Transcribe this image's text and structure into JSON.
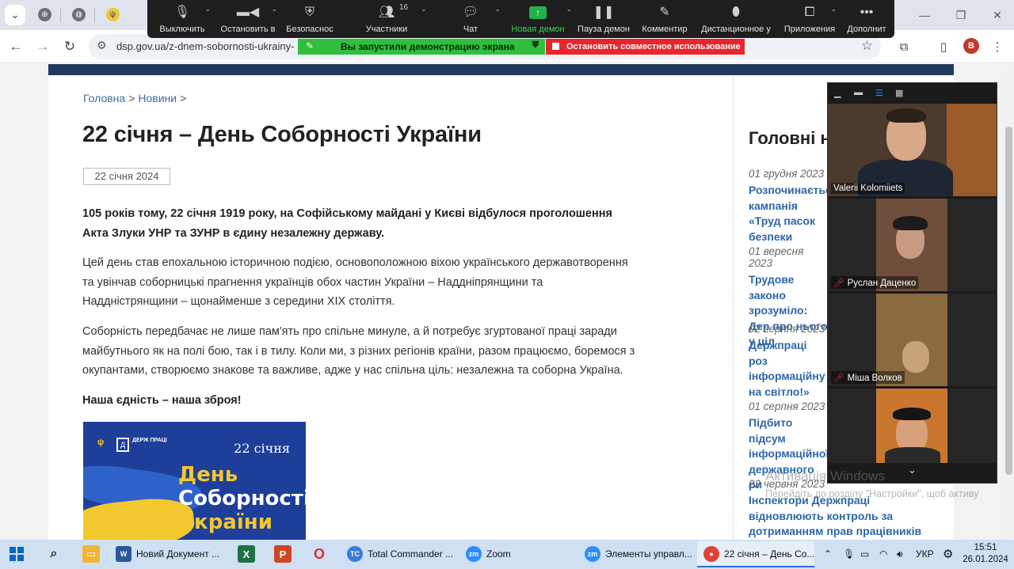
{
  "browser": {
    "url": "dsp.gov.ua/z-dnem-sobornosti-ukrainy-",
    "profile_initial": "B"
  },
  "zoom_toolbar": {
    "items": [
      {
        "label": "Выключить",
        "icon": "microphone-icon"
      },
      {
        "label": "Остановить в",
        "icon": "video-camera-icon"
      },
      {
        "label": "Безопаснос",
        "icon": "shield-icon"
      },
      {
        "label": "Участники",
        "icon": "participants-icon",
        "count": "16"
      },
      {
        "label": "Чат",
        "icon": "chat-icon"
      },
      {
        "label": "Новая демон",
        "icon": "share-screen-icon"
      },
      {
        "label": "Пауза демон",
        "icon": "pause-icon"
      },
      {
        "label": "Комментир",
        "icon": "pencil-icon"
      },
      {
        "label": "Дистанционное у",
        "icon": "mouse-icon"
      },
      {
        "label": "Приложения",
        "icon": "apps-icon"
      },
      {
        "label": "Дополнит",
        "icon": "more-icon"
      }
    ],
    "share_banner": "Вы запустили демонстрацию экрана",
    "stop_share": "Остановить совместное использование",
    "accent_green": "#2fbf3d",
    "accent_red": "#e8262d"
  },
  "article": {
    "breadcrumb": [
      "Головна",
      "Новини"
    ],
    "title": "22 січня – День Соборності України",
    "date": "22 січня 2024",
    "lead": "105 років тому, 22 січня 1919 року, на Софійському майдані у Києві відбулося проголошення Акта Злуки УНР та ЗУНР в єдину незалежну державу.",
    "p1": "Цей день став епохальною історичною подією, основоположною віхою українського державотворення та увінчав соборницькі прагнення українців обох частин України – Наддніпрянщини та Наддністрянщини – щонайменше з середини XIX століття.",
    "p2": "Соборність передбачає не лише пам'ять про спільне минуле, а й потребує згуртованої праці заради майбутнього як на полі бою, так і в тилу. Коли ми, з різних регіонів країни, разом працюємо, боремося з окупантами, створюємо знакове та важливе, адже у нас спільна ціль: незалежна та соборна Україна.",
    "motto": "Наша єдність – наша зброя!",
    "banner": {
      "logo_text": "ДЕРЖ ПРАЦІ",
      "date": "22 січня",
      "line1": "День",
      "line2": "Соборності",
      "line3": "України"
    }
  },
  "sidebar": {
    "title": "Головні новини",
    "items": [
      {
        "date": "01 грудня 2023",
        "title": "Розпочинаєтьс кампанія «Труд пасок безпеки"
      },
      {
        "date": "01 вересня 2023",
        "title": "Трудове законо зрозуміло: Дер про нього у ціл"
      },
      {
        "date": "02 серпня 2023",
        "title": "Держпраці роз інформаційну на світло!»"
      },
      {
        "date": "01 серпня 2023",
        "title": "Підбито підсум інформаційної державного ри"
      },
      {
        "date": "22 червня 2023",
        "title": "Інспектори Держпраці відновлюють контроль за дотриманням прав працівників"
      }
    ]
  },
  "zoom_panel": {
    "participants": [
      {
        "name": "Valerii Kolomiiets",
        "muted": false
      },
      {
        "name": "Руслан Даценко",
        "muted": true
      },
      {
        "name": "Міша Волков",
        "muted": true
      },
      {
        "name": "",
        "muted": false
      }
    ]
  },
  "watermark": {
    "title": "Активація Windows",
    "text": "Перейдіть до розділу \"Настройки\", щоб активувати Windows."
  },
  "taskbar": {
    "apps": [
      {
        "label": "Новий Документ ...",
        "icon": "word-icon",
        "color": "#2b579a"
      },
      {
        "label": "Total Commander ...",
        "icon": "total-commander-icon",
        "color": "#3a7bd5"
      },
      {
        "label": "Zoom",
        "icon": "zoom-icon",
        "color": "#2d8cff"
      },
      {
        "label": "Элементы управл...",
        "icon": "zoom-icon",
        "color": "#2d8cff"
      },
      {
        "label": "22 січня – День Со...",
        "icon": "chrome-icon",
        "color": "#db4437"
      }
    ],
    "language": "УКР",
    "time": "15:51",
    "date": "26.01.2024"
  }
}
